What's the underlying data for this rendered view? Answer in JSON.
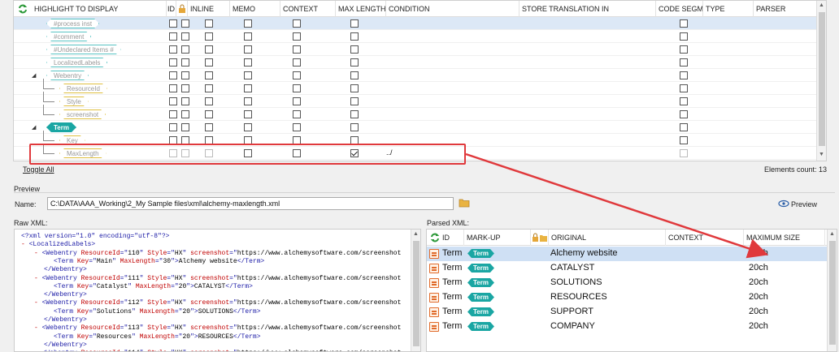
{
  "grid": {
    "columns": [
      "HIGHLIGHT TO DISPLAY",
      "ID",
      "",
      "INLINE",
      "MEMO",
      "CONTEXT",
      "MAX LENGTH",
      "CONDITION",
      "STORE TRANSLATION IN",
      "CODE SEGMENT",
      "TYPE",
      "PARSER"
    ],
    "rows": [
      {
        "tag": "#process inst",
        "style": "cyan",
        "indent": 0,
        "ml": false,
        "disabled": false,
        "condition": ""
      },
      {
        "tag": "#comment",
        "style": "cyan",
        "indent": 0,
        "ml": false,
        "disabled": false,
        "condition": ""
      },
      {
        "tag": "#Undeclared Items #",
        "style": "cyan",
        "indent": 0,
        "ml": false,
        "disabled": false,
        "condition": ""
      },
      {
        "tag": "LocalizedLabels",
        "style": "cyan",
        "indent": 0,
        "ml": false,
        "disabled": false,
        "condition": ""
      },
      {
        "tag": "Webentry",
        "style": "cyan",
        "indent": 0,
        "ml": false,
        "disabled": false,
        "condition": "",
        "expander": true
      },
      {
        "tag": "ResourceId",
        "style": "yellow",
        "indent": 1,
        "ml": false,
        "disabled": false,
        "condition": ""
      },
      {
        "tag": "Style",
        "style": "yellow",
        "indent": 1,
        "ml": false,
        "disabled": false,
        "condition": ""
      },
      {
        "tag": "screenshot",
        "style": "yellow",
        "indent": 1,
        "ml": false,
        "disabled": false,
        "condition": ""
      },
      {
        "tag": "Term",
        "style": "term",
        "indent": 0,
        "ml": false,
        "disabled": false,
        "condition": "",
        "expander": true
      },
      {
        "tag": "Key",
        "style": "yellow",
        "indent": 1,
        "ml": false,
        "disabled": false,
        "condition": ""
      },
      {
        "tag": "MaxLength",
        "style": "yellow",
        "indent": 1,
        "ml": true,
        "disabled": true,
        "condition": "../"
      }
    ],
    "toggle_all": "Toggle All",
    "elements_count": "Elements count: 13"
  },
  "preview": {
    "title": "Preview",
    "name_label": "Name:",
    "name_value": "C:\\DATA\\AAA_Working\\2_My Sample files\\xml\\alchemy-maxlength.xml",
    "preview_button": "Preview",
    "raw_label": "Raw XML:",
    "parsed_label": "Parsed XML:"
  },
  "raw_xml": [
    {
      "indent": 2,
      "parts": [
        [
          "xbl",
          "<?xml version=\"1.0\" encoding=\"utf-8\"?>"
        ]
      ]
    },
    {
      "indent": 2,
      "parts": [
        [
          "xred",
          "- "
        ],
        [
          "xbl",
          "<LocalizedLabels>"
        ]
      ]
    },
    {
      "indent": 6,
      "parts": [
        [
          "xred",
          "- "
        ],
        [
          "xbl",
          "<Webentry "
        ],
        [
          "xred",
          "ResourceId"
        ],
        [
          "xbl",
          "=\""
        ],
        [
          "xblack",
          "110"
        ],
        [
          "xbl",
          "\" "
        ],
        [
          "xred",
          "Style"
        ],
        [
          "xbl",
          "=\""
        ],
        [
          "xblack",
          "HX"
        ],
        [
          "xbl",
          "\" "
        ],
        [
          "xred",
          "screenshot"
        ],
        [
          "xbl",
          "=\""
        ],
        [
          "xblack",
          "https://www.alchemysoftware.com/screenshot"
        ]
      ]
    },
    {
      "indent": 12,
      "parts": [
        [
          "xbl",
          "<Term "
        ],
        [
          "xred",
          "Key"
        ],
        [
          "xbl",
          "=\""
        ],
        [
          "xblack",
          "Main"
        ],
        [
          "xbl",
          "\" "
        ],
        [
          "xred",
          "MaxLength"
        ],
        [
          "xbl",
          "=\""
        ],
        [
          "xblack",
          "30"
        ],
        [
          "xbl",
          "\">"
        ],
        [
          "xblack",
          "Alchemy website"
        ],
        [
          "xbl",
          "</Term>"
        ]
      ]
    },
    {
      "indent": 9,
      "parts": [
        [
          "xbl",
          "</Webentry>"
        ]
      ]
    },
    {
      "indent": 6,
      "parts": [
        [
          "xred",
          "- "
        ],
        [
          "xbl",
          "<Webentry "
        ],
        [
          "xred",
          "ResourceId"
        ],
        [
          "xbl",
          "=\""
        ],
        [
          "xblack",
          "111"
        ],
        [
          "xbl",
          "\" "
        ],
        [
          "xred",
          "Style"
        ],
        [
          "xbl",
          "=\""
        ],
        [
          "xblack",
          "HX"
        ],
        [
          "xbl",
          "\" "
        ],
        [
          "xred",
          "screenshot"
        ],
        [
          "xbl",
          "=\""
        ],
        [
          "xblack",
          "https://www.alchemysoftware.com/screenshot"
        ]
      ]
    },
    {
      "indent": 12,
      "parts": [
        [
          "xbl",
          "<Term "
        ],
        [
          "xred",
          "Key"
        ],
        [
          "xbl",
          "=\""
        ],
        [
          "xblack",
          "Catalyst"
        ],
        [
          "xbl",
          "\" "
        ],
        [
          "xred",
          "MaxLength"
        ],
        [
          "xbl",
          "=\""
        ],
        [
          "xblack",
          "20"
        ],
        [
          "xbl",
          "\">"
        ],
        [
          "xblack",
          "CATALYST"
        ],
        [
          "xbl",
          "</Term>"
        ]
      ]
    },
    {
      "indent": 9,
      "parts": [
        [
          "xbl",
          "</Webentry>"
        ]
      ]
    },
    {
      "indent": 6,
      "parts": [
        [
          "xred",
          "- "
        ],
        [
          "xbl",
          "<Webentry "
        ],
        [
          "xred",
          "ResourceId"
        ],
        [
          "xbl",
          "=\""
        ],
        [
          "xblack",
          "112"
        ],
        [
          "xbl",
          "\" "
        ],
        [
          "xred",
          "Style"
        ],
        [
          "xbl",
          "=\""
        ],
        [
          "xblack",
          "HX"
        ],
        [
          "xbl",
          "\" "
        ],
        [
          "xred",
          "screenshot"
        ],
        [
          "xbl",
          "=\""
        ],
        [
          "xblack",
          "https://www.alchemysoftware.com/screenshot"
        ]
      ]
    },
    {
      "indent": 12,
      "parts": [
        [
          "xbl",
          "<Term "
        ],
        [
          "xred",
          "Key"
        ],
        [
          "xbl",
          "=\""
        ],
        [
          "xblack",
          "Solutions"
        ],
        [
          "xbl",
          "\" "
        ],
        [
          "xred",
          "MaxLength"
        ],
        [
          "xbl",
          "=\""
        ],
        [
          "xblack",
          "20"
        ],
        [
          "xbl",
          "\">"
        ],
        [
          "xblack",
          "SOLUTIONS"
        ],
        [
          "xbl",
          "</Term>"
        ]
      ]
    },
    {
      "indent": 9,
      "parts": [
        [
          "xbl",
          "</Webentry>"
        ]
      ]
    },
    {
      "indent": 6,
      "parts": [
        [
          "xred",
          "- "
        ],
        [
          "xbl",
          "<Webentry "
        ],
        [
          "xred",
          "ResourceId"
        ],
        [
          "xbl",
          "=\""
        ],
        [
          "xblack",
          "113"
        ],
        [
          "xbl",
          "\" "
        ],
        [
          "xred",
          "Style"
        ],
        [
          "xbl",
          "=\""
        ],
        [
          "xblack",
          "HX"
        ],
        [
          "xbl",
          "\" "
        ],
        [
          "xred",
          "screenshot"
        ],
        [
          "xbl",
          "=\""
        ],
        [
          "xblack",
          "https://www.alchemysoftware.com/screenshot"
        ]
      ]
    },
    {
      "indent": 12,
      "parts": [
        [
          "xbl",
          "<Term "
        ],
        [
          "xred",
          "Key"
        ],
        [
          "xbl",
          "=\""
        ],
        [
          "xblack",
          "Resources"
        ],
        [
          "xbl",
          "\" "
        ],
        [
          "xred",
          "MaxLength"
        ],
        [
          "xbl",
          "=\""
        ],
        [
          "xblack",
          "20"
        ],
        [
          "xbl",
          "\">"
        ],
        [
          "xblack",
          "RESOURCES"
        ],
        [
          "xbl",
          "</Term>"
        ]
      ]
    },
    {
      "indent": 9,
      "parts": [
        [
          "xbl",
          "</Webentry>"
        ]
      ]
    },
    {
      "indent": 6,
      "parts": [
        [
          "xred",
          "- "
        ],
        [
          "xbl",
          "<Webentry "
        ],
        [
          "xred",
          "ResourceId"
        ],
        [
          "xbl",
          "=\""
        ],
        [
          "xblack",
          "114"
        ],
        [
          "xbl",
          "\" "
        ],
        [
          "xred",
          "Style"
        ],
        [
          "xbl",
          "=\""
        ],
        [
          "xblack",
          "HX"
        ],
        [
          "xbl",
          "\" "
        ],
        [
          "xred",
          "screenshot"
        ],
        [
          "xbl",
          "=\""
        ],
        [
          "xblack",
          "https://www.alchemysoftware.com/screenshot"
        ]
      ]
    }
  ],
  "parsed": {
    "columns": [
      "ID",
      "MARK-UP",
      "",
      "ORIGINAL",
      "CONTEXT",
      "MAXIMUM SIZE"
    ],
    "rows": [
      {
        "id": "Term",
        "markup": "Term",
        "original": "Alchemy website",
        "context": "",
        "max": "30ch",
        "selected": true
      },
      {
        "id": "Term",
        "markup": "Term",
        "original": "CATALYST",
        "context": "",
        "max": "20ch",
        "selected": false
      },
      {
        "id": "Term",
        "markup": "Term",
        "original": "SOLUTIONS",
        "context": "",
        "max": "20ch",
        "selected": false
      },
      {
        "id": "Term",
        "markup": "Term",
        "original": "RESOURCES",
        "context": "",
        "max": "20ch",
        "selected": false
      },
      {
        "id": "Term",
        "markup": "Term",
        "original": "SUPPORT",
        "context": "",
        "max": "20ch",
        "selected": false
      },
      {
        "id": "Term",
        "markup": "Term",
        "original": "COMPANY",
        "context": "",
        "max": "20ch",
        "selected": false
      }
    ]
  },
  "colors": {
    "accent_red": "#e0393c",
    "term_teal": "#1aa6a3",
    "selection": "#dce8f6"
  },
  "icons": [
    "refresh-icon",
    "lock-icon",
    "folder-icon",
    "eye-icon",
    "xml-file-icon"
  ]
}
